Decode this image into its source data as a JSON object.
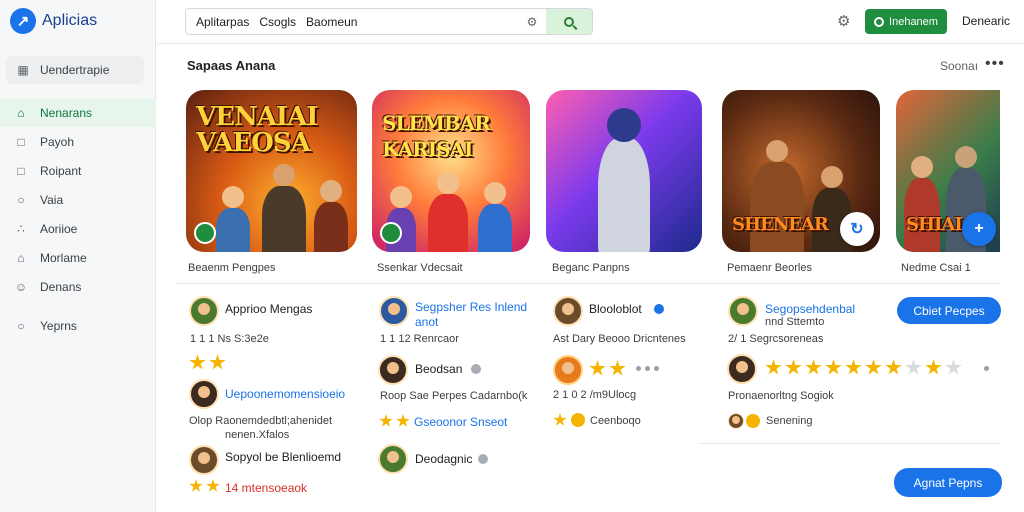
{
  "app": {
    "name": "Aplicias"
  },
  "sidebar": {
    "top_item": "Uendertrapie",
    "items": [
      {
        "label": "Nenarans",
        "icon": "home-icon",
        "active": true
      },
      {
        "label": "Payoh",
        "icon": "square-icon",
        "active": false
      },
      {
        "label": "Roipant",
        "icon": "square-icon",
        "active": false
      },
      {
        "label": "Vaia",
        "icon": "circle-icon",
        "active": false
      },
      {
        "label": "Aoriioe",
        "icon": "chart-icon",
        "active": false
      },
      {
        "label": "Morlame",
        "icon": "house-icon",
        "active": false
      },
      {
        "label": "Denans",
        "icon": "person-icon",
        "active": false
      },
      {
        "label": "Yeprns",
        "icon": "circle-icon",
        "active": false
      }
    ]
  },
  "header": {
    "search": {
      "chip": "Aplitarpas",
      "placeholder": "Csogls   Baomeun"
    },
    "primary_button": "Inehanem",
    "account": "Denearic"
  },
  "section": {
    "title": "Sapaas Anana",
    "see_more": "Soonaı"
  },
  "cards": [
    {
      "title": "VENAIAI VAEOSA",
      "label": "Beaenm Pengpes",
      "badge": true,
      "action": ""
    },
    {
      "title": "SLEMBAR KARISAI",
      "label": "Ssenkar Vdecsait",
      "badge": true,
      "action": ""
    },
    {
      "title": "",
      "label": "Beganc Panpns",
      "badge": false,
      "action": ""
    },
    {
      "title": "SHENEAR",
      "label": "Pemaenr Beorles",
      "badge": false,
      "action": "↻"
    },
    {
      "title": "SHIAI",
      "label": "Nedme Csai 1",
      "badge": false,
      "action": "+"
    }
  ],
  "reviews": {
    "col1": {
      "name": "Apprioo Mengas",
      "meta": "1 1  1 Ns  S:3e2e",
      "person": "Uepoonemomensioeio",
      "text": "Olop Raonemdedbtl;ahenidet",
      "subtext": "nenen.Xfalos",
      "person2": "Sopyol be Blenlioemd",
      "person2_meta": "14 mtensoeaok"
    },
    "col2": {
      "name": "Segpsher Res Inlend",
      "name2": "anot",
      "meta": "1 1  12 Renrcaor",
      "person": "Beodsan",
      "text": "Roop Sae Perpes Cadarnbo(k",
      "link": "Gseoonor Snseot",
      "person2": "Deodagnic"
    },
    "col3": {
      "name": "Blooloblot",
      "meta": "Ast  Dary Beooo Dricntenes",
      "meta2": "2 1 0 2 /m9Ulocg",
      "person": "Ceenboqo"
    },
    "col4": {
      "name": "Segopsehdenbal",
      "name2": "nnd Sttemto",
      "meta": "2/ 1 Segrcsoreneas",
      "text": "Pronaenorltng Sogiok",
      "person": "Senening",
      "button": "Cbiet Pecpes",
      "button2": "Agnat Pepns"
    }
  },
  "colors": {
    "accent": "#1a73e8",
    "primary_green": "#1e8e3e",
    "star": "#f4b400"
  }
}
